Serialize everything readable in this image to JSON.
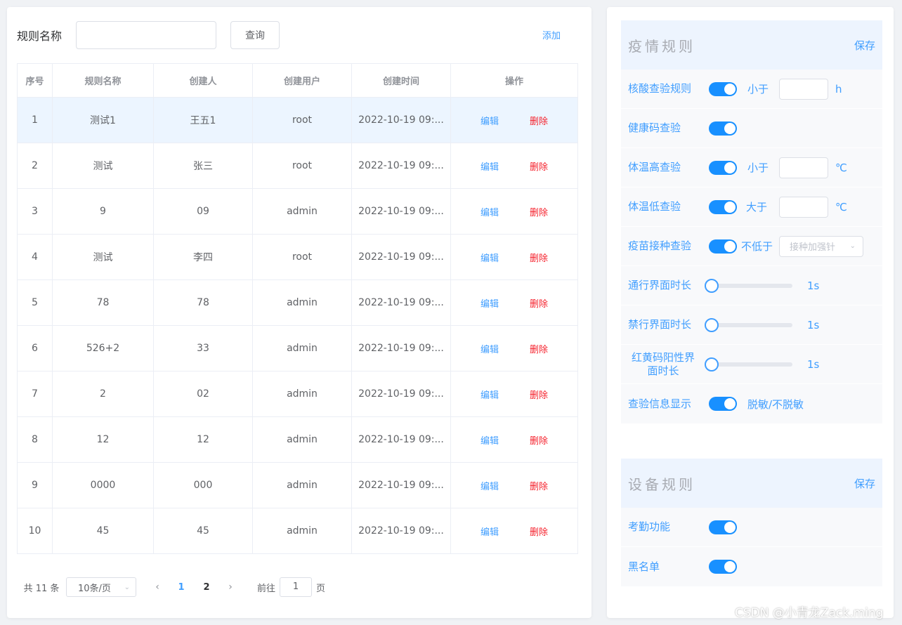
{
  "search": {
    "label": "规则名称",
    "value": "",
    "query_label": "查询",
    "add_label": "添加"
  },
  "table": {
    "headers": [
      "序号",
      "规则名称",
      "创建人",
      "创建用户",
      "创建时间",
      "操作"
    ],
    "edit_label": "编辑",
    "delete_label": "删除",
    "rows": [
      {
        "idx": "1",
        "name": "测试1",
        "creator": "王五1",
        "user": "root",
        "time": "2022-10-19 09:..."
      },
      {
        "idx": "2",
        "name": "测试",
        "creator": "张三",
        "user": "root",
        "time": "2022-10-19 09:..."
      },
      {
        "idx": "3",
        "name": "9",
        "creator": "09",
        "user": "admin",
        "time": "2022-10-19 09:..."
      },
      {
        "idx": "4",
        "name": "测试",
        "creator": "李四",
        "user": "root",
        "time": "2022-10-19 09:..."
      },
      {
        "idx": "5",
        "name": "78",
        "creator": "78",
        "user": "admin",
        "time": "2022-10-19 09:..."
      },
      {
        "idx": "6",
        "name": "526+2",
        "creator": "33",
        "user": "admin",
        "time": "2022-10-19 09:..."
      },
      {
        "idx": "7",
        "name": "2",
        "creator": "02",
        "user": "admin",
        "time": "2022-10-19 09:..."
      },
      {
        "idx": "8",
        "name": "12",
        "creator": "12",
        "user": "admin",
        "time": "2022-10-19 09:..."
      },
      {
        "idx": "9",
        "name": "0000",
        "creator": "000",
        "user": "admin",
        "time": "2022-10-19 09:..."
      },
      {
        "idx": "10",
        "name": "45",
        "creator": "45",
        "user": "admin",
        "time": "2022-10-19 09:..."
      }
    ]
  },
  "pager": {
    "total": "共 11 条",
    "page_size": "10条/页",
    "pages": [
      "1",
      "2"
    ],
    "current": "1",
    "goto_label": "前往",
    "goto_value": "1",
    "page_suffix": "页"
  },
  "epidemic": {
    "title": "疫情规则",
    "save": "保存",
    "nucleic": {
      "label": "核酸查验规则",
      "enabled": true,
      "cmp": "小于",
      "value": "",
      "unit": "h"
    },
    "health_code": {
      "label": "健康码查验",
      "enabled": true
    },
    "temp_high": {
      "label": "体温高查验",
      "enabled": true,
      "cmp": "小于",
      "value": "",
      "unit": "℃"
    },
    "temp_low": {
      "label": "体温低查验",
      "enabled": true,
      "cmp": "大于",
      "value": "",
      "unit": "℃"
    },
    "vaccine": {
      "label": "疫苗接种查验",
      "enabled": true,
      "cmp": "不低于",
      "select": "接种加强针"
    },
    "pass_duration": {
      "label": "通行界面时长",
      "value": "1s",
      "level": 0
    },
    "deny_duration": {
      "label": "禁行界面时长",
      "value": "1s",
      "level": 0
    },
    "red_yellow_duration": {
      "label": "红黄码阳性界面时长",
      "value": "1s",
      "level": 0
    },
    "info_display": {
      "label": "查验信息显示",
      "enabled": true,
      "text": "脱敏/不脱敏"
    }
  },
  "device": {
    "title": "设备规则",
    "save": "保存",
    "attendance": {
      "label": "考勤功能",
      "enabled": true
    },
    "blacklist": {
      "label": "黑名单",
      "enabled": true
    }
  },
  "watermark": "CSDN @小青龙Zack.ming",
  "colors": {
    "primary": "#409eff",
    "danger": "#f5222d",
    "switch_on": "#1890ff",
    "header_bg": "#edf4fe",
    "selected_row": "#ecf5ff"
  }
}
